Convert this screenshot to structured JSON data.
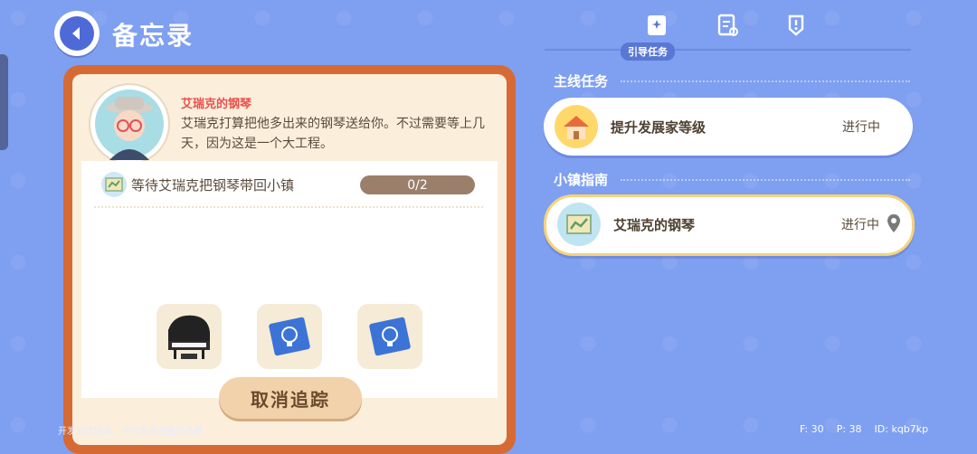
{
  "header": {
    "title": "备忘录"
  },
  "npc": {
    "name": "艾瑞克的钢琴",
    "description": "艾瑞克打算把他多出来的钢琴送给你。不过需要等上几天，因为这是一个大工程。"
  },
  "task": {
    "text": "等待艾瑞克把钢琴带回小镇",
    "progress": "0/2"
  },
  "rewards": [
    {
      "icon": "piano-icon"
    },
    {
      "icon": "blueprint-icon"
    },
    {
      "icon": "blueprint-icon"
    }
  ],
  "actions": {
    "cancel_label": "取消追踪"
  },
  "tabs": {
    "active_label": "引导任务",
    "items": [
      "guide-task-icon",
      "checklist-icon",
      "quest-alert-icon"
    ]
  },
  "sections": [
    {
      "title": "主线任务",
      "quests": [
        {
          "name": "提升发展家等级",
          "status": "进行中",
          "icon": "house-icon"
        }
      ]
    },
    {
      "title": "小镇指南",
      "quests": [
        {
          "name": "艾瑞克的钢琴",
          "status": "进行中",
          "icon": "map-icon",
          "pinned": true
        }
      ]
    }
  ],
  "footer": {
    "note": "开发测试版本，不代表游戏最终品质",
    "f": "F: 30",
    "p": "P: 38",
    "id": "ID: kqb7kp"
  },
  "colors": {
    "background": "#7f9ff0",
    "card_frame": "#d66a35",
    "npc_name": "#e9504a",
    "active_border": "#f6d37a"
  }
}
